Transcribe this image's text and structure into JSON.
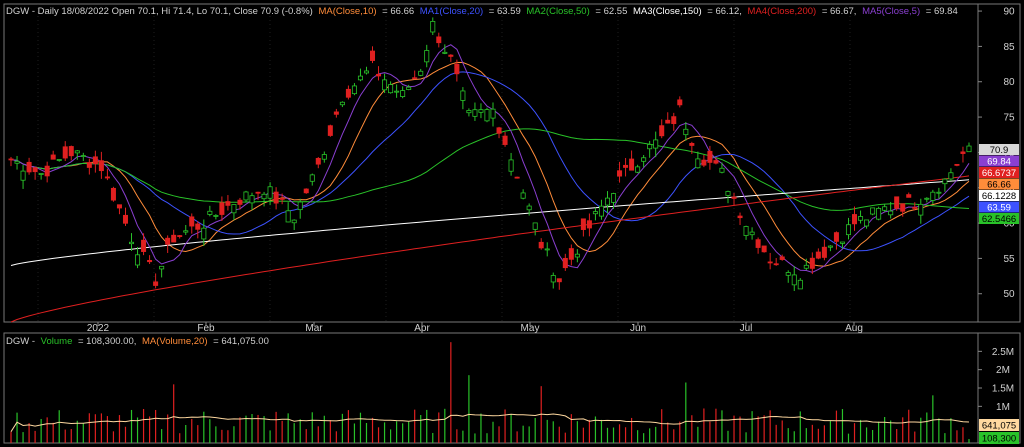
{
  "price_header": {
    "symbol_line": "DGW - Daily 18/08/2022 Open 70.1, Hi 71.4, Lo 70.1, Close 70.9 (-0.8%)",
    "ma": {
      "label": "MA(Close,10)",
      "value": "= 66.66",
      "color": "#ff8c3a"
    },
    "ma1": {
      "label": "MA1(Close,20)",
      "value": "= 63.59",
      "color": "#3d52ff"
    },
    "ma2": {
      "label": "MA2(Close,50)",
      "value": "= 62.55",
      "color": "#29c229"
    },
    "ma3": {
      "label": "MA3(Close,150)",
      "value": "= 66.12,",
      "color": "#ffffff"
    },
    "ma4": {
      "label": "MA4(Close,200)",
      "value": "= 66.67,",
      "color": "#e02020"
    },
    "ma5": {
      "label": "MA5(Close,5)",
      "value": "= 69.84",
      "color": "#8a3fd1"
    }
  },
  "volume_header": {
    "symbol": "DGW -",
    "volume_label": "Volume",
    "volume_value": "= 108,300.00,",
    "ma_label": "MA(Volume,20)",
    "ma_value": "= 641,075.00"
  },
  "price_axis_ticks": [
    "90",
    "85",
    "80",
    "75",
    "70",
    "65",
    "60",
    "55",
    "50"
  ],
  "price_badges": [
    {
      "text": "70.9",
      "bg": "#d8d8d8",
      "fg": "#000000"
    },
    {
      "text": "69.84",
      "bg": "#8a3fd1",
      "fg": "#ffffff"
    },
    {
      "text": "66.6737",
      "bg": "#e02020",
      "fg": "#ffffff"
    },
    {
      "text": "66.66",
      "bg": "#ff8c3a",
      "fg": "#000000"
    },
    {
      "text": "66.1228",
      "bg": "#ffffff",
      "fg": "#000000"
    },
    {
      "text": "63.59",
      "bg": "#3d52ff",
      "fg": "#ffffff"
    },
    {
      "text": "62.5466",
      "bg": "#29c229",
      "fg": "#000000"
    }
  ],
  "volume_axis_ticks": [
    "2.5M",
    "2M",
    "1.5M",
    "1M"
  ],
  "volume_badges": [
    {
      "text": "641,075",
      "bg": "#ffd9a0",
      "fg": "#000000"
    },
    {
      "text": "108,300",
      "bg": "#29c229",
      "fg": "#000000"
    }
  ],
  "month_labels": [
    "2022",
    "Feb",
    "Mar",
    "Apr",
    "May",
    "Jun",
    "Jul",
    "Aug"
  ],
  "colors": {
    "up": "#29c229",
    "down": "#e02020",
    "axis": "#777777",
    "grid": "#333333"
  },
  "chart_data": {
    "type": "candlestick",
    "symbol": "DGW",
    "period": "Daily",
    "last": {
      "date": "18/08/2022",
      "open": 70.1,
      "high": 71.4,
      "low": 70.1,
      "close": 70.9,
      "change_pct": -0.8
    },
    "price_ylim": [
      46,
      91
    ],
    "volume_ylim": [
      0,
      3000000
    ],
    "x_ticks": [
      "2022",
      "Feb",
      "Mar",
      "Apr",
      "May",
      "Jun",
      "Jul",
      "Aug"
    ],
    "close_series_keypoints": [
      [
        0,
        69
      ],
      [
        5,
        67
      ],
      [
        10,
        70
      ],
      [
        15,
        68
      ],
      [
        20,
        58
      ],
      [
        24,
        52
      ],
      [
        27,
        58
      ],
      [
        32,
        60
      ],
      [
        37,
        63
      ],
      [
        42,
        65
      ],
      [
        47,
        61
      ],
      [
        51,
        68
      ],
      [
        55,
        78
      ],
      [
        60,
        82
      ],
      [
        65,
        78
      ],
      [
        68,
        82
      ],
      [
        70,
        88
      ],
      [
        73,
        83
      ],
      [
        76,
        75
      ],
      [
        80,
        76
      ],
      [
        84,
        67
      ],
      [
        88,
        57
      ],
      [
        91,
        52
      ],
      [
        95,
        58
      ],
      [
        100,
        65
      ],
      [
        105,
        70
      ],
      [
        108,
        72
      ],
      [
        111,
        76
      ],
      [
        114,
        70
      ],
      [
        118,
        67
      ],
      [
        122,
        60
      ],
      [
        126,
        55
      ],
      [
        131,
        53
      ],
      [
        135,
        56
      ],
      [
        140,
        60
      ],
      [
        145,
        62
      ],
      [
        150,
        63
      ],
      [
        155,
        66
      ],
      [
        159,
        71
      ]
    ],
    "moving_averages": [
      {
        "name": "MA(Close,10)",
        "period": 10,
        "last": 66.66
      },
      {
        "name": "MA1(Close,20)",
        "period": 20,
        "last": 63.59
      },
      {
        "name": "MA2(Close,50)",
        "period": 50,
        "last": 62.55
      },
      {
        "name": "MA3(Close,150)",
        "period": 150,
        "last": 66.12
      },
      {
        "name": "MA4(Close,200)",
        "period": 200,
        "last": 66.67
      },
      {
        "name": "MA5(Close,5)",
        "period": 5,
        "last": 69.84
      }
    ],
    "volume": {
      "last": 108300,
      "ma20": 641075,
      "spikes": [
        [
          27,
          1600000
        ],
        [
          73,
          2750000
        ],
        [
          76,
          1850000
        ],
        [
          88,
          1550000
        ],
        [
          112,
          1650000
        ],
        [
          153,
          1300000
        ]
      ]
    }
  }
}
